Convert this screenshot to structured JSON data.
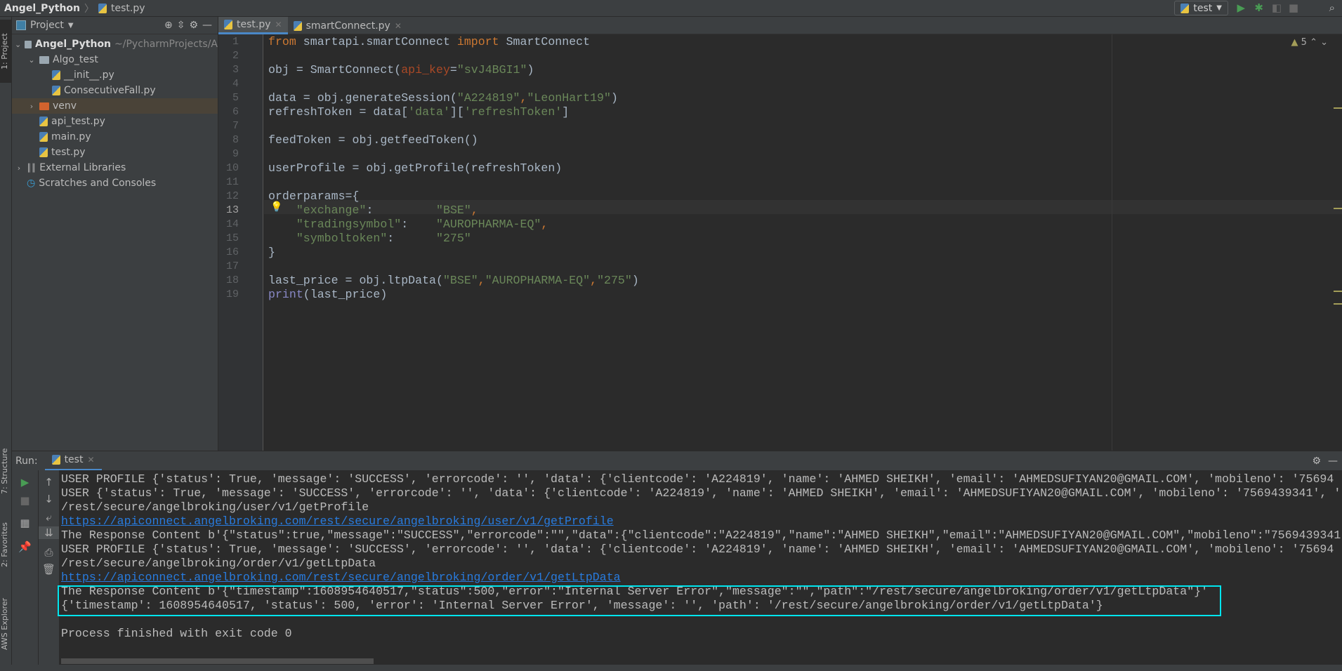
{
  "titlebar": {
    "project": "Angel_Python",
    "file": "test.py"
  },
  "toolbar": {
    "run_config": "test",
    "icons": [
      "run-icon",
      "debug-icon",
      "coverage-icon",
      "stop-icon",
      "search-icon"
    ]
  },
  "leftstrip": {
    "project": "1: Project",
    "structure": "7: Structure",
    "favorites": "2: Favorites",
    "aws": "AWS Explorer"
  },
  "project": {
    "title": "Project",
    "tree": [
      {
        "label": "Angel_Python",
        "hint": "~/PycharmProjects/A",
        "type": "folder",
        "indent": 0,
        "arrow": "⌄",
        "bold": true
      },
      {
        "label": "Algo_test",
        "type": "folder",
        "indent": 1,
        "arrow": "⌄"
      },
      {
        "label": "__init__.py",
        "type": "py",
        "indent": 2
      },
      {
        "label": "ConsecutiveFall.py",
        "type": "py",
        "indent": 2
      },
      {
        "label": "venv",
        "type": "venv",
        "indent": 1,
        "arrow": "›",
        "selected": true
      },
      {
        "label": "api_test.py",
        "type": "py",
        "indent": 1
      },
      {
        "label": "main.py",
        "type": "py",
        "indent": 1
      },
      {
        "label": "test.py",
        "type": "py",
        "indent": 1
      },
      {
        "label": "External Libraries",
        "type": "lib",
        "indent": 0,
        "arrow": "›"
      },
      {
        "label": "Scratches and Consoles",
        "type": "scratch",
        "indent": 0
      }
    ]
  },
  "tabs": [
    {
      "label": "test.py",
      "active": true
    },
    {
      "label": "smartConnect.py",
      "active": false
    }
  ],
  "editor": {
    "warnings": "5",
    "current_line": 13,
    "lines": [
      [
        [
          "from",
          "kw"
        ],
        [
          " smartapi.smartConnect ",
          ""
        ],
        [
          "import",
          "kw"
        ],
        [
          " SmartConnect",
          ""
        ]
      ],
      [],
      [
        [
          "obj = SmartConnect(",
          ""
        ],
        [
          "api_key",
          "param"
        ],
        [
          "=",
          ""
        ],
        [
          "\"svJ4BGI1\"",
          "str"
        ],
        [
          ")",
          ""
        ]
      ],
      [],
      [
        [
          "data = obj.generateSession(",
          ""
        ],
        [
          "\"A224819\"",
          "str"
        ],
        [
          ",",
          "kw"
        ],
        [
          "\"LeonHart19\"",
          "str"
        ],
        [
          ")",
          ""
        ]
      ],
      [
        [
          "refreshToken = data[",
          ""
        ],
        [
          "'data'",
          "str"
        ],
        [
          "][",
          ""
        ],
        [
          "'refreshToken'",
          "str"
        ],
        [
          "]",
          ""
        ]
      ],
      [],
      [
        [
          "feedToken = obj.getfeedToken()",
          ""
        ]
      ],
      [],
      [
        [
          "userProfile = obj.getProfile(refreshToken)",
          ""
        ]
      ],
      [],
      [
        [
          "orderparams={",
          ""
        ]
      ],
      [
        [
          "    ",
          ""
        ],
        [
          "\"exchange\"",
          "str"
        ],
        [
          ":         ",
          ""
        ],
        [
          "\"BSE\"",
          "str"
        ],
        [
          ",",
          "kw"
        ]
      ],
      [
        [
          "    ",
          ""
        ],
        [
          "\"tradingsymbol\"",
          "str"
        ],
        [
          ":    ",
          ""
        ],
        [
          "\"AUROPHARMA-EQ\"",
          "str"
        ],
        [
          ",",
          "kw"
        ]
      ],
      [
        [
          "    ",
          ""
        ],
        [
          "\"symboltoken\"",
          "str"
        ],
        [
          ":      ",
          ""
        ],
        [
          "\"275\"",
          "str"
        ]
      ],
      [
        [
          "}",
          ""
        ]
      ],
      [],
      [
        [
          "last_price = obj.ltpData(",
          ""
        ],
        [
          "\"BSE\"",
          "str"
        ],
        [
          ",",
          "kw"
        ],
        [
          "\"AUROPHARMA-EQ\"",
          "str"
        ],
        [
          ",",
          "kw"
        ],
        [
          "\"275\"",
          "str"
        ],
        [
          ")",
          ""
        ]
      ],
      [
        [
          "print",
          "bi"
        ],
        [
          "(last_price)",
          ""
        ]
      ]
    ]
  },
  "run": {
    "label": "Run:",
    "tab": "test",
    "console": [
      {
        "text": "USER PROFILE {'status': True, 'message': 'SUCCESS', 'errorcode': '', 'data': {'clientcode': 'A224819', 'name': 'AHMED SHEIKH', 'email': 'AHMEDSUFIYAN20@GMAIL.COM', 'mobileno': '75694"
      },
      {
        "text": "USER {'status': True, 'message': 'SUCCESS', 'errorcode': '', 'data': {'clientcode': 'A224819', 'name': 'AHMED SHEIKH', 'email': 'AHMEDSUFIYAN20@GMAIL.COM', 'mobileno': '7569439341', '"
      },
      {
        "text": "/rest/secure/angelbroking/user/v1/getProfile"
      },
      {
        "text": "https://apiconnect.angelbroking.com/rest/secure/angelbroking/user/v1/getProfile",
        "link": true
      },
      {
        "text": "The Response Content b'{\"status\":true,\"message\":\"SUCCESS\",\"errorcode\":\"\",\"data\":{\"clientcode\":\"A224819\",\"name\":\"AHMED SHEIKH\",\"email\":\"AHMEDSUFIYAN20@GMAIL.COM\",\"mobileno\":\"7569439341"
      },
      {
        "text": "USER PROFILE {'status': True, 'message': 'SUCCESS', 'errorcode': '', 'data': {'clientcode': 'A224819', 'name': 'AHMED SHEIKH', 'email': 'AHMEDSUFIYAN20@GMAIL.COM', 'mobileno': '75694"
      },
      {
        "text": "/rest/secure/angelbroking/order/v1/getLtpData"
      },
      {
        "text": "https://apiconnect.angelbroking.com/rest/secure/angelbroking/order/v1/getLtpData",
        "link": true
      },
      {
        "text": "The Response Content b'{\"timestamp\":1608954640517,\"status\":500,\"error\":\"Internal Server Error\",\"message\":\"\",\"path\":\"/rest/secure/angelbroking/order/v1/getLtpData\"}'"
      },
      {
        "text": "{'timestamp': 1608954640517, 'status': 500, 'error': 'Internal Server Error', 'message': '', 'path': '/rest/secure/angelbroking/order/v1/getLtpData'}"
      },
      {
        "text": ""
      },
      {
        "text": "Process finished with exit code 0"
      }
    ]
  },
  "colors": {
    "highlight_box": "#00e5ee",
    "keyword": "#cc7832",
    "string": "#6a8759",
    "link": "#287bde"
  }
}
